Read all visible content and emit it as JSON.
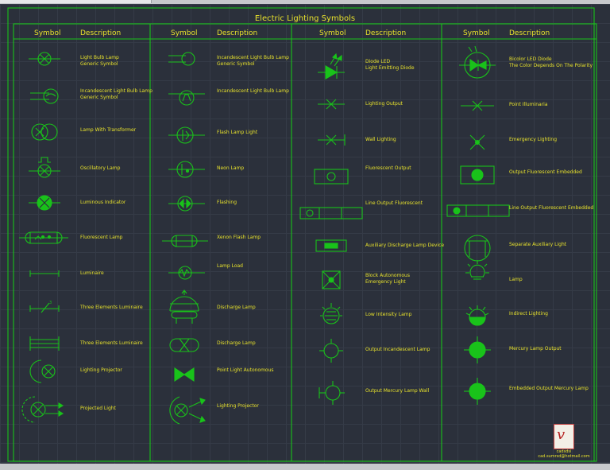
{
  "title": "Electric Lighting Symbols",
  "headers": {
    "symbol": "Symbol",
    "description": "Description"
  },
  "col1": [
    {
      "icon": "light-bulb-lamp-icon",
      "desc": "Light Bulb Lamp\nGeneric Symbol"
    },
    {
      "icon": "incandescent-light-bulb-lamp-icon",
      "desc": "Incandescent Light Bulb Lamp\nGeneric Symbol"
    },
    {
      "icon": "lamp-with-transformer-icon",
      "desc": "Lamp With Transformer"
    },
    {
      "icon": "oscillatory-lamp-icon",
      "desc": "Oscillatory Lamp"
    },
    {
      "icon": "luminous-indicator-icon",
      "desc": "Luminous Indicator"
    },
    {
      "icon": "fluorescent-lamp-icon",
      "desc": "Fluorescent Lamp"
    },
    {
      "icon": "luminaire-icon",
      "desc": "Luminaire"
    },
    {
      "icon": "three-elements-luminaire-icon",
      "desc": "Three Elements Luminaire"
    },
    {
      "icon": "three-elements-luminaire-box-icon",
      "desc": "Three Elements Luminaire"
    },
    {
      "icon": "lighting-projector-icon",
      "desc": "Lighting Projector"
    },
    {
      "icon": "projected-light-icon",
      "desc": "Projected Light"
    }
  ],
  "col2": [
    {
      "icon": "incandescent-light-bulb-lamp-icon",
      "desc": "Incandescent Light Bulb Lamp\nGeneric Symbol"
    },
    {
      "icon": "incandescent-light-bulb-lamp-icon",
      "desc": "Incandescent Light Bulb Lamp"
    },
    {
      "icon": "flash-lamp-light-icon",
      "desc": "Flash Lamp Light"
    },
    {
      "icon": "neon-lamp-icon",
      "desc": "Neon Lamp"
    },
    {
      "icon": "flashing-icon",
      "desc": "Flashing"
    },
    {
      "icon": "xenon-flash-lamp-icon",
      "desc": "Xenon Flash Lamp"
    },
    {
      "icon": "lamp-load-icon",
      "desc": "Lamp Load"
    },
    {
      "icon": "discharge-lamp-icon",
      "desc": "Discharge Lamp"
    },
    {
      "icon": "discharge-lamp-small-icon",
      "desc": "Discharge Lamp"
    },
    {
      "icon": "point-light-autonomous-icon",
      "desc": "Point Light Autonomous"
    },
    {
      "icon": "lighting-projector-icon",
      "desc": "Lighting Projector"
    }
  ],
  "col3": [
    {
      "icon": "diode-led-icon",
      "desc": "Diode LED\nLight Emitting Diode"
    },
    {
      "icon": "lighting-output-icon",
      "desc": "Lighting Output"
    },
    {
      "icon": "wall-lighting-icon",
      "desc": "Wall Lighting"
    },
    {
      "icon": "fluorescent-output-icon",
      "desc": "Fluorescent Output"
    },
    {
      "icon": "line-output-fluorescent-icon",
      "desc": "Line Output Fluorescent"
    },
    {
      "icon": "auxiliary-discharge-lamp-device-icon",
      "desc": "Auxiliary Discharge Lamp Device"
    },
    {
      "icon": "block-autonomous-emergency-light-icon",
      "desc": "Block Autonomous\nEmergency Light"
    },
    {
      "icon": "low-intensity-lamp-icon",
      "desc": "Low Intensity Lamp"
    },
    {
      "icon": "output-incandescent-lamp-icon",
      "desc": "Output Incandescent Lamp"
    },
    {
      "icon": "output-mercury-lamp-wall-icon",
      "desc": "Output Mercury Lamp Wall"
    }
  ],
  "col4": [
    {
      "icon": "bicolor-led-diode-icon",
      "desc": "Bicolor LED Diode\nThe Color Depends On The Polarity"
    },
    {
      "icon": "point-illuminaria-icon",
      "desc": "Point Illuminaria"
    },
    {
      "icon": "emergency-lighting-icon",
      "desc": "Emergency Lighting"
    },
    {
      "icon": "output-fluorescent-embedded-icon",
      "desc": "Output Fluorescent Embedded"
    },
    {
      "icon": "line-output-fluorescent-embedded-icon",
      "desc": "Line Output Fluorescent Embedded"
    },
    {
      "icon": "separate-auxiliary-light-icon",
      "desc": "Separate Auxiliary Light"
    },
    {
      "icon": "lamp-icon",
      "desc": "Lamp"
    },
    {
      "icon": "indirect-lighting-icon",
      "desc": "Indirect Lighting"
    },
    {
      "icon": "mercury-lamp-output-icon",
      "desc": "Mercury Lamp Output"
    },
    {
      "icon": "embedded-output-mercury-lamp-icon",
      "desc": "Embedded Output Mercury Lamp"
    }
  ],
  "credit": {
    "name": "cadsdsi",
    "email": "cad.sumrsd@hotmail.com"
  },
  "colors": {
    "line": "#19c21a",
    "text": "#e8e22c",
    "background": "#2b303b",
    "grid": "#353b47"
  }
}
